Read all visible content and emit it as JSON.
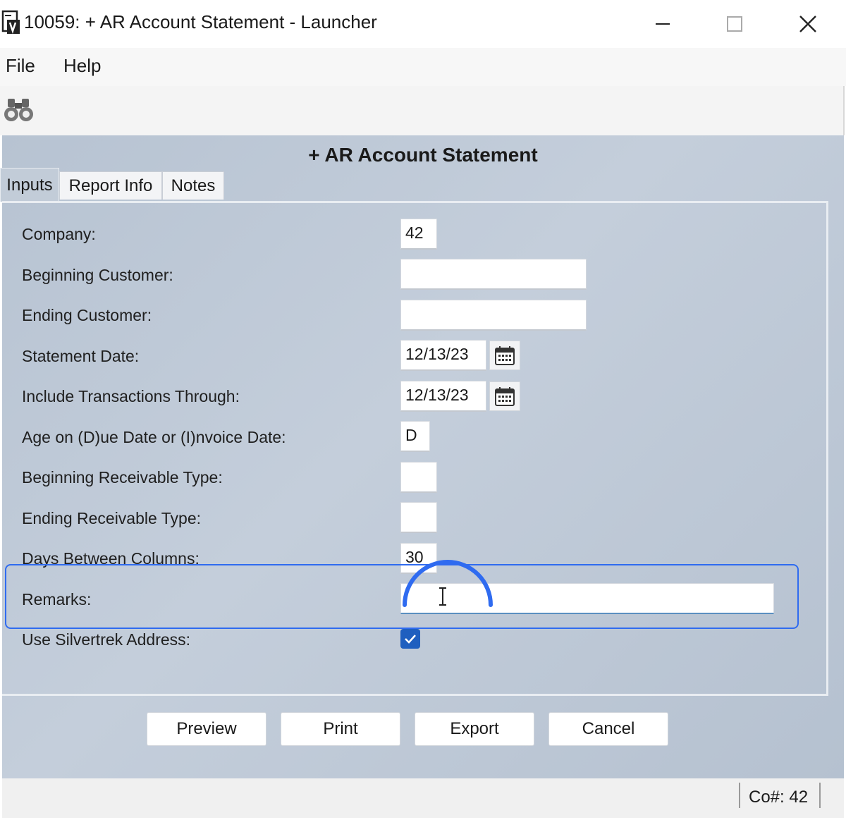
{
  "window": {
    "title": "10059: + AR Account Statement - Launcher",
    "app_icon": "report-app-icon",
    "controls": [
      "minimize-icon",
      "maximize-icon",
      "close-icon"
    ]
  },
  "menu": {
    "file": "File",
    "help": "Help"
  },
  "toolbar": {
    "icons": [
      "binoculars-icon"
    ]
  },
  "form": {
    "title": "+ AR Account Statement",
    "tabs": {
      "inputs": "Inputs",
      "report_info": "Report Info",
      "notes": "Notes",
      "active": "Inputs"
    },
    "fields": {
      "company": {
        "label": "Company:",
        "value": "42"
      },
      "beginning_customer": {
        "label": "Beginning Customer:",
        "value": ""
      },
      "ending_customer": {
        "label": "Ending Customer:",
        "value": ""
      },
      "statement_date": {
        "label": "Statement Date:",
        "value": "12/13/23"
      },
      "include_through": {
        "label": "Include Transactions Through:",
        "value": "12/13/23"
      },
      "age_on": {
        "label": "Age on (D)ue Date or (I)nvoice Date:",
        "value": "D"
      },
      "beginning_receivable_type": {
        "label": "Beginning Receivable Type:",
        "value": ""
      },
      "ending_receivable_type": {
        "label": "Ending Receivable Type:",
        "value": ""
      },
      "days_between_columns": {
        "label": "Days Between Columns:",
        "value": "30"
      },
      "remarks": {
        "label": "Remarks:",
        "value": ""
      },
      "use_silvertrek_address": {
        "label": "Use Silvertrek Address:",
        "checked": true
      }
    },
    "buttons": {
      "preview": "Preview",
      "print": "Print",
      "export": "Export",
      "cancel": "Cancel"
    }
  },
  "status": {
    "company": "Co#: 42"
  },
  "colors": {
    "accent_highlight": "#2f6bf0",
    "checkbox_fill": "#1f5fbf",
    "panel_bg": "#bcc7d5"
  }
}
